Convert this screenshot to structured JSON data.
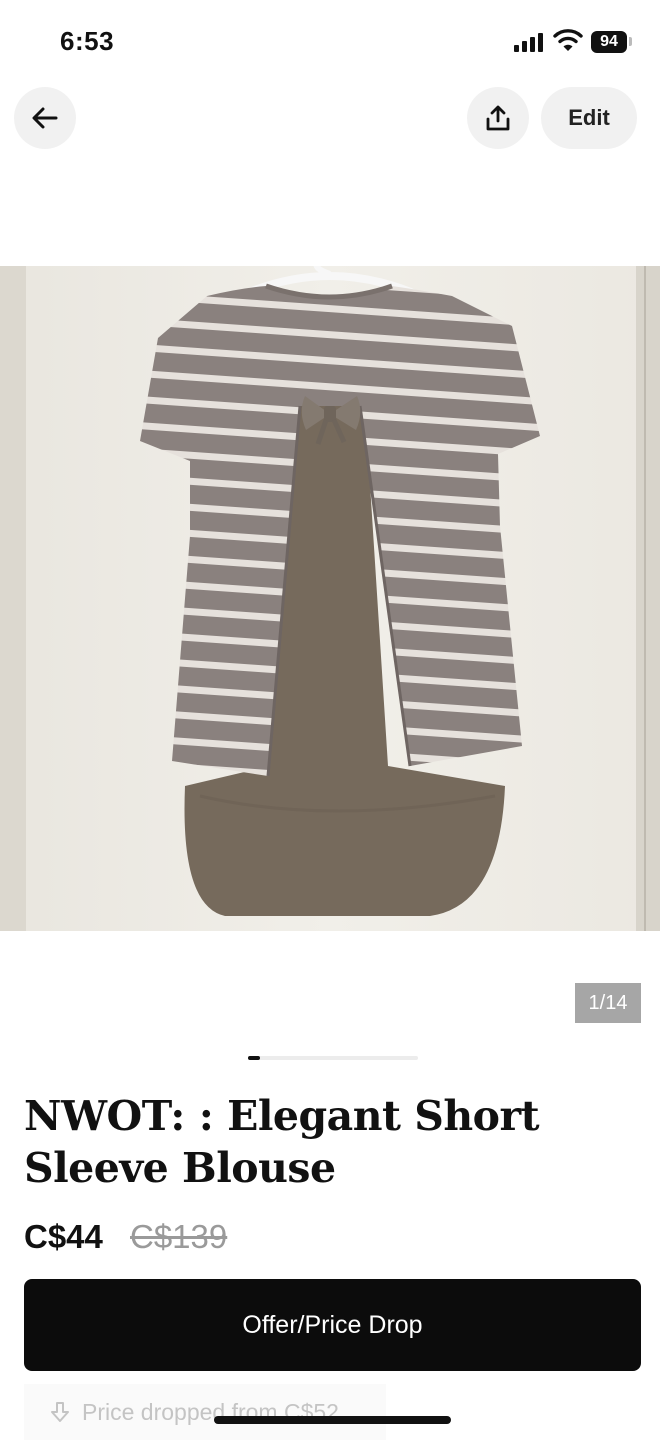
{
  "status_bar": {
    "time": "6:53",
    "battery": "94"
  },
  "header": {
    "back_icon": "arrow-left-icon",
    "share_icon": "share-icon",
    "edit_label": "Edit"
  },
  "gallery": {
    "counter": "1/14",
    "current_index": 1,
    "total": 14,
    "image_subject": "striped short sleeve blouse with bow and chiffon back on hanger"
  },
  "listing": {
    "title": "NWOT: : Elegant Short Sleeve Blouse",
    "price": "C$44",
    "original_price": "C$139"
  },
  "actions": {
    "offer_label": "Offer/Price Drop",
    "price_drop_text": "Price dropped from C$52",
    "price_drop_icon": "arrow-down-icon"
  },
  "colors": {
    "primary_button": "#0c0c0c",
    "muted_text": "#9a9a9a",
    "counter_bg": "#a6a6a6"
  }
}
